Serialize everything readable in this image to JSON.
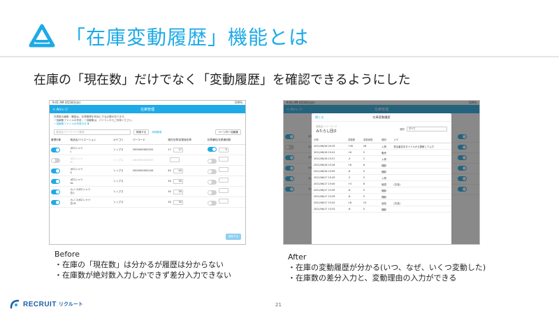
{
  "slide": {
    "title": "「在庫変動履歴」機能とは",
    "subtitle": "在庫の「現在数」だけでなく「変動履歴」を確認できるようにした",
    "page_number": "21",
    "logo_text": "RECRUIT",
    "logo_jp": "リクルート",
    "accent_color": "#1eaae7"
  },
  "before_screen": {
    "status_left": "9:41 AM 4月18日(水)",
    "status_right": "100%",
    "back_label": "< Airレジ",
    "title": "在庫管理",
    "desc_line1": "在庫数の編集・確認は、在庫管理を有効にする必要があります。",
    "desc_line2": "一括編集ファイルの作成・一括編集は、パソコンからご利用ください。",
    "desc_link": "一括編集ファイルの作成方法 ▼",
    "search_placeholder": "商品名/バーコードで検索",
    "search_button": "検索する",
    "detail_link": "詳細検索",
    "bulk_button": "ページ内一括編集",
    "columns": [
      "管理対象",
      "商品名/バリエーション",
      "カテゴリ",
      "バーコード",
      "現在在庫/変更後在庫",
      "在庫通知/在庫通知数"
    ],
    "rows": [
      {
        "on": true,
        "name": "ボロシャツ",
        "variant": "L",
        "category": "トップス",
        "barcode": "2000000000220",
        "current": "17",
        "new": "17",
        "notify": true,
        "notify_count": "5",
        "dim": false
      },
      {
        "on": false,
        "name": "ボロシャツ",
        "variant": "M",
        "category": "トップス",
        "barcode": "2000000000037",
        "current": "",
        "new": "",
        "notify": false,
        "notify_count": "",
        "dim": true
      },
      {
        "on": true,
        "name": "ボロシャツ",
        "variant": "S",
        "category": "トップス",
        "barcode": "2000000000244",
        "current": "40",
        "new": "40",
        "notify": false,
        "notify_count": "",
        "dim": false
      },
      {
        "on": true,
        "name": "ボロシャツ",
        "variant": "XL",
        "category": "トップス",
        "barcode": "",
        "current": "30",
        "new": "30",
        "notify": false,
        "notify_count": "",
        "dim": false
      },
      {
        "on": true,
        "name": "カノコボロシャツ",
        "variant": "白 L",
        "category": "トップス",
        "barcode": "",
        "current": "30",
        "new": "30",
        "notify": false,
        "notify_count": "",
        "dim": false
      },
      {
        "on": true,
        "name": "カノコボロシャツ",
        "variant": "白 M",
        "category": "トップス",
        "barcode": "",
        "current": "30",
        "new": "30",
        "notify": false,
        "notify_count": "",
        "dim": false
      }
    ],
    "save_button": "保存する"
  },
  "after_screen": {
    "modal_close": "閉じる",
    "modal_title": "在庫変動履歴",
    "item_label": "商品名 / バーコード",
    "item_name": "みたらし団子",
    "filter_label": "種別",
    "filter_value": "すべて",
    "columns": [
      "日時",
      "変動数",
      "変動後数",
      "種別",
      "メモ"
    ],
    "rows": [
      {
        "date": "2021/06/18 20:33",
        "delta": "+30",
        "after": "28",
        "type": "入荷",
        "memo": "担当者名をタイトルから更新して入力"
      },
      {
        "date": "2021/06/18 15:41",
        "delta": "+6",
        "after": "5",
        "type": "販売",
        "memo": ""
      },
      {
        "date": "2021/06/18 15:27",
        "delta": "-3",
        "after": "1",
        "type": "入荷",
        "memo": ""
      },
      {
        "date": "2021/06/18 15:26",
        "delta": "+6",
        "after": "6",
        "type": "棚卸",
        "memo": ""
      },
      {
        "date": "2021/06/18 15:09",
        "delta": "-8",
        "after": "0",
        "type": "棚卸",
        "memo": ""
      },
      {
        "date": "2021/06/17 15:43",
        "delta": "-2",
        "after": "5",
        "type": "入荷",
        "memo": ""
      },
      {
        "date": "2021/06/17 15:40",
        "delta": "+3",
        "after": "8",
        "type": "破損",
        "memo": "(欠品)"
      },
      {
        "date": "2021/06/17 15:39",
        "delta": "-8",
        "after": "5",
        "type": "棚卸",
        "memo": ""
      },
      {
        "date": "2021/06/17 15:39",
        "delta": "-8",
        "after": "5",
        "type": "棚卸",
        "memo": ""
      },
      {
        "date": "2021/06/17 15:32",
        "delta": "+8",
        "after": "13",
        "type": "返品",
        "memo": "(欠品)"
      },
      {
        "date": "2021/06/17 15:32",
        "delta": "-6",
        "after": "5",
        "type": "棚卸",
        "memo": ""
      }
    ]
  },
  "captions": {
    "before_title": "Before",
    "before_line1": "・在庫の「現在数」は分かるが履歴は分からない",
    "before_line2": "・在庫数が絶対数入力しかできず差分入力できない",
    "after_title": "After",
    "after_line1": "・在庫の変動履歴が分かる(いつ、なぜ、いくつ変動した)",
    "after_line2": "・在庫数の差分入力と、変動理由の入力ができる"
  }
}
